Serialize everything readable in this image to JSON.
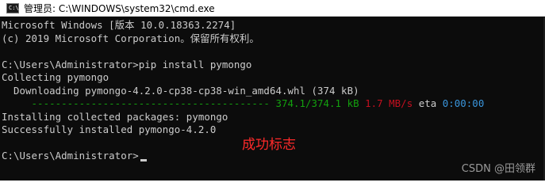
{
  "window": {
    "title": "管理员: C:\\WINDOWS\\system32\\cmd.exe",
    "icon": "cmd-icon",
    "icon_glyph": "C:\\"
  },
  "console": {
    "lines": {
      "l1": "Microsoft Windows [版本 10.0.18363.2274]",
      "l2": "(c) 2019 Microsoft Corporation。保留所有权利。",
      "l3": "C:\\Users\\Administrator>pip install pymongo",
      "l4": "Collecting pymongo",
      "l5": "  Downloading pymongo-4.2.0-cp38-cp38-win_amd64.whl (374 kB)",
      "l6_bar": "     ----------------------------------------",
      "l6_size": " 374.1/374.1 kB",
      "l6_speed": " 1.7 MB/s",
      "l6_eta_label": " eta",
      "l6_eta_value": " 0:00:00",
      "l7": "Installing collected packages: pymongo",
      "l8": "Successfully installed pymongo-4.2.0",
      "l9": "C:\\Users\\Administrator>"
    },
    "colors": {
      "background": "#0c0c0c",
      "text": "#cccccc",
      "progress_green": "#13a10e",
      "speed_red": "#c50f1f",
      "eta_blue": "#3a96dd"
    }
  },
  "annotation": {
    "text": "成功标志",
    "color": "#ff2a2a"
  },
  "watermark": {
    "text": "CSDN @田领群"
  }
}
